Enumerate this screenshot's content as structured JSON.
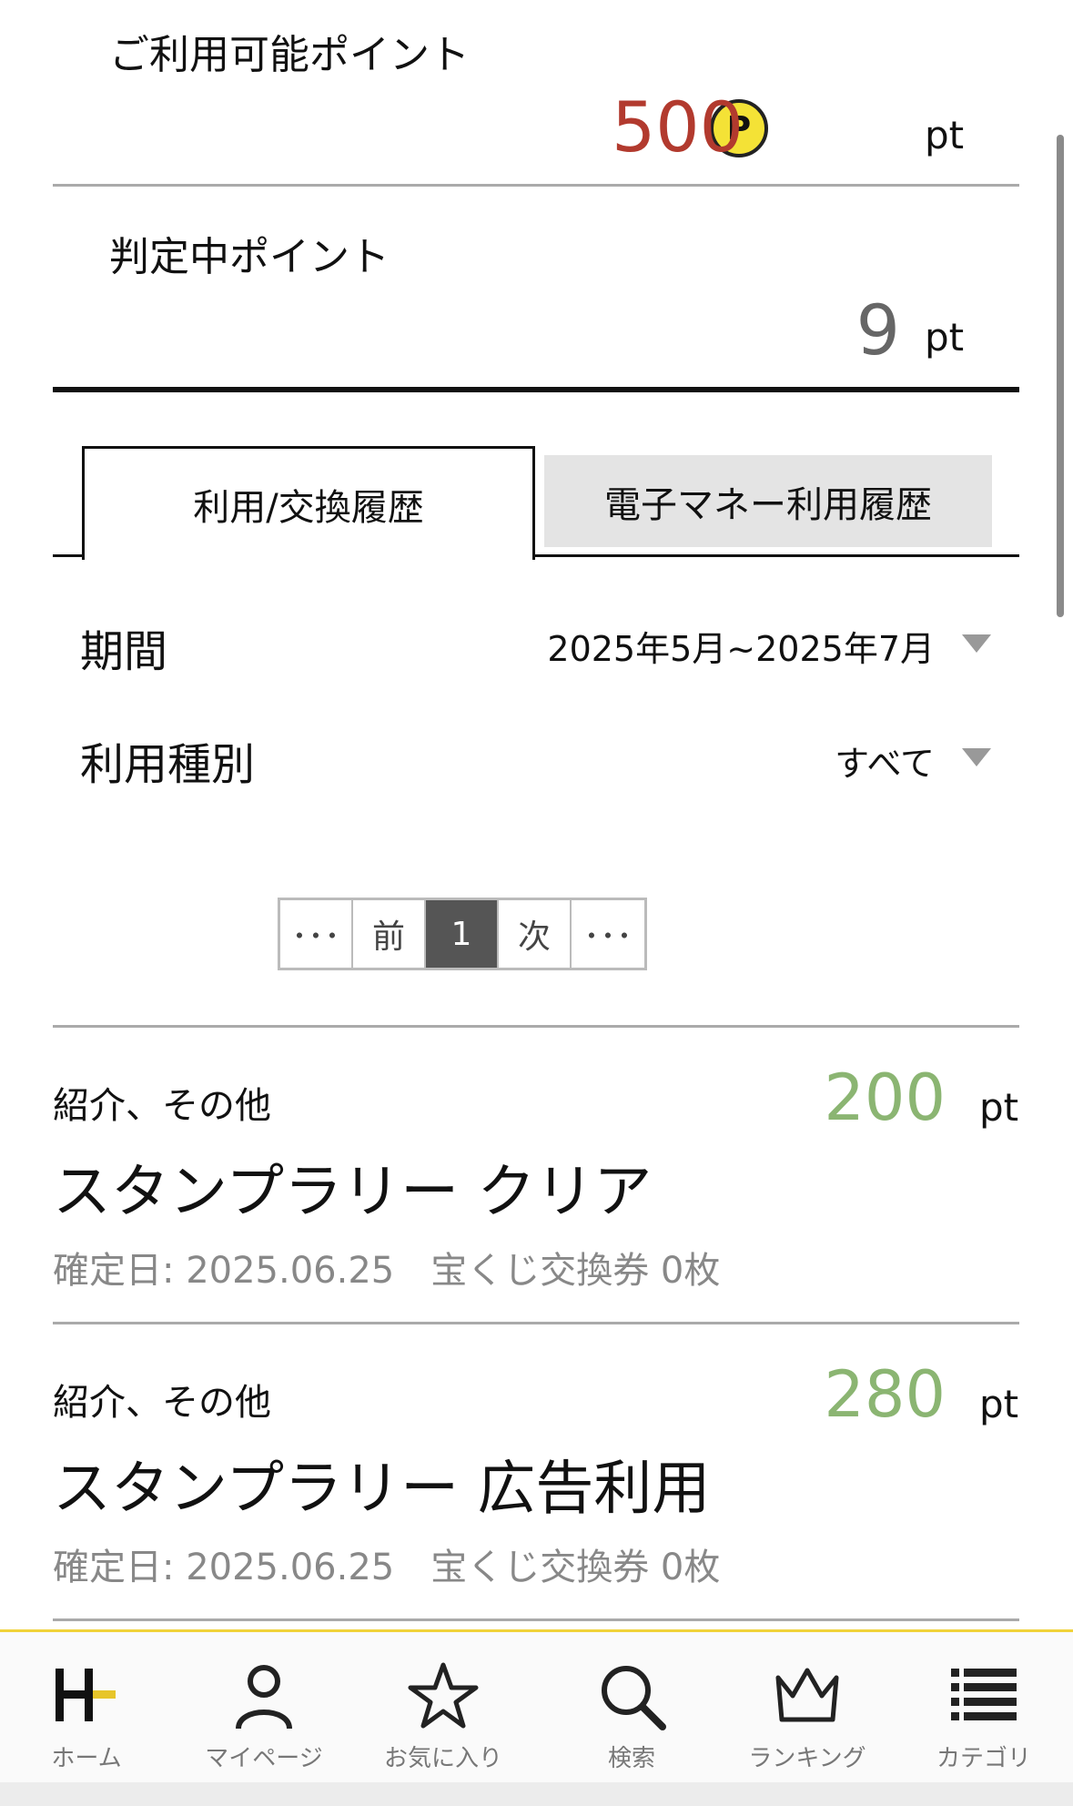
{
  "points": {
    "available_label": "ご利用可能ポイント",
    "available_value": "500",
    "coin_letter": "P",
    "unit": "pt",
    "pending_label": "判定中ポイント",
    "pending_value": "9"
  },
  "tabs": [
    {
      "label": "利用/交換履歴",
      "active": true
    },
    {
      "label": "電子マネー利用履歴",
      "active": false
    }
  ],
  "filters": {
    "period_label": "期間",
    "period_value": "2025年5月~2025年7月",
    "type_label": "利用種別",
    "type_value": "すべて"
  },
  "pagination": {
    "first": "･･･",
    "prev": "前",
    "current": "1",
    "next": "次",
    "last": "･･･"
  },
  "records": [
    {
      "category": "紹介、その他",
      "title": "スタンプラリー クリア",
      "meta": "確定日: 2025.06.25　宝くじ交換券 0枚",
      "amount": "200",
      "unit": "pt"
    },
    {
      "category": "紹介、その他",
      "title": "スタンプラリー 広告利用",
      "meta": "確定日: 2025.06.25　宝くじ交換券 0枚",
      "amount": "280",
      "unit": "pt"
    }
  ],
  "bottom_nav": [
    {
      "label": "ホーム",
      "icon": "home-logo-icon"
    },
    {
      "label": "マイページ",
      "icon": "person-icon"
    },
    {
      "label": "お気に入り",
      "icon": "star-icon"
    },
    {
      "label": "検索",
      "icon": "search-icon"
    },
    {
      "label": "ランキング",
      "icon": "crown-icon"
    },
    {
      "label": "カテゴリ",
      "icon": "list-icon"
    }
  ],
  "colors": {
    "available_value": "#b23a2e",
    "record_amount": "#8bb572",
    "coin": "#f4e236",
    "nav_accent": "#f0d23a"
  }
}
